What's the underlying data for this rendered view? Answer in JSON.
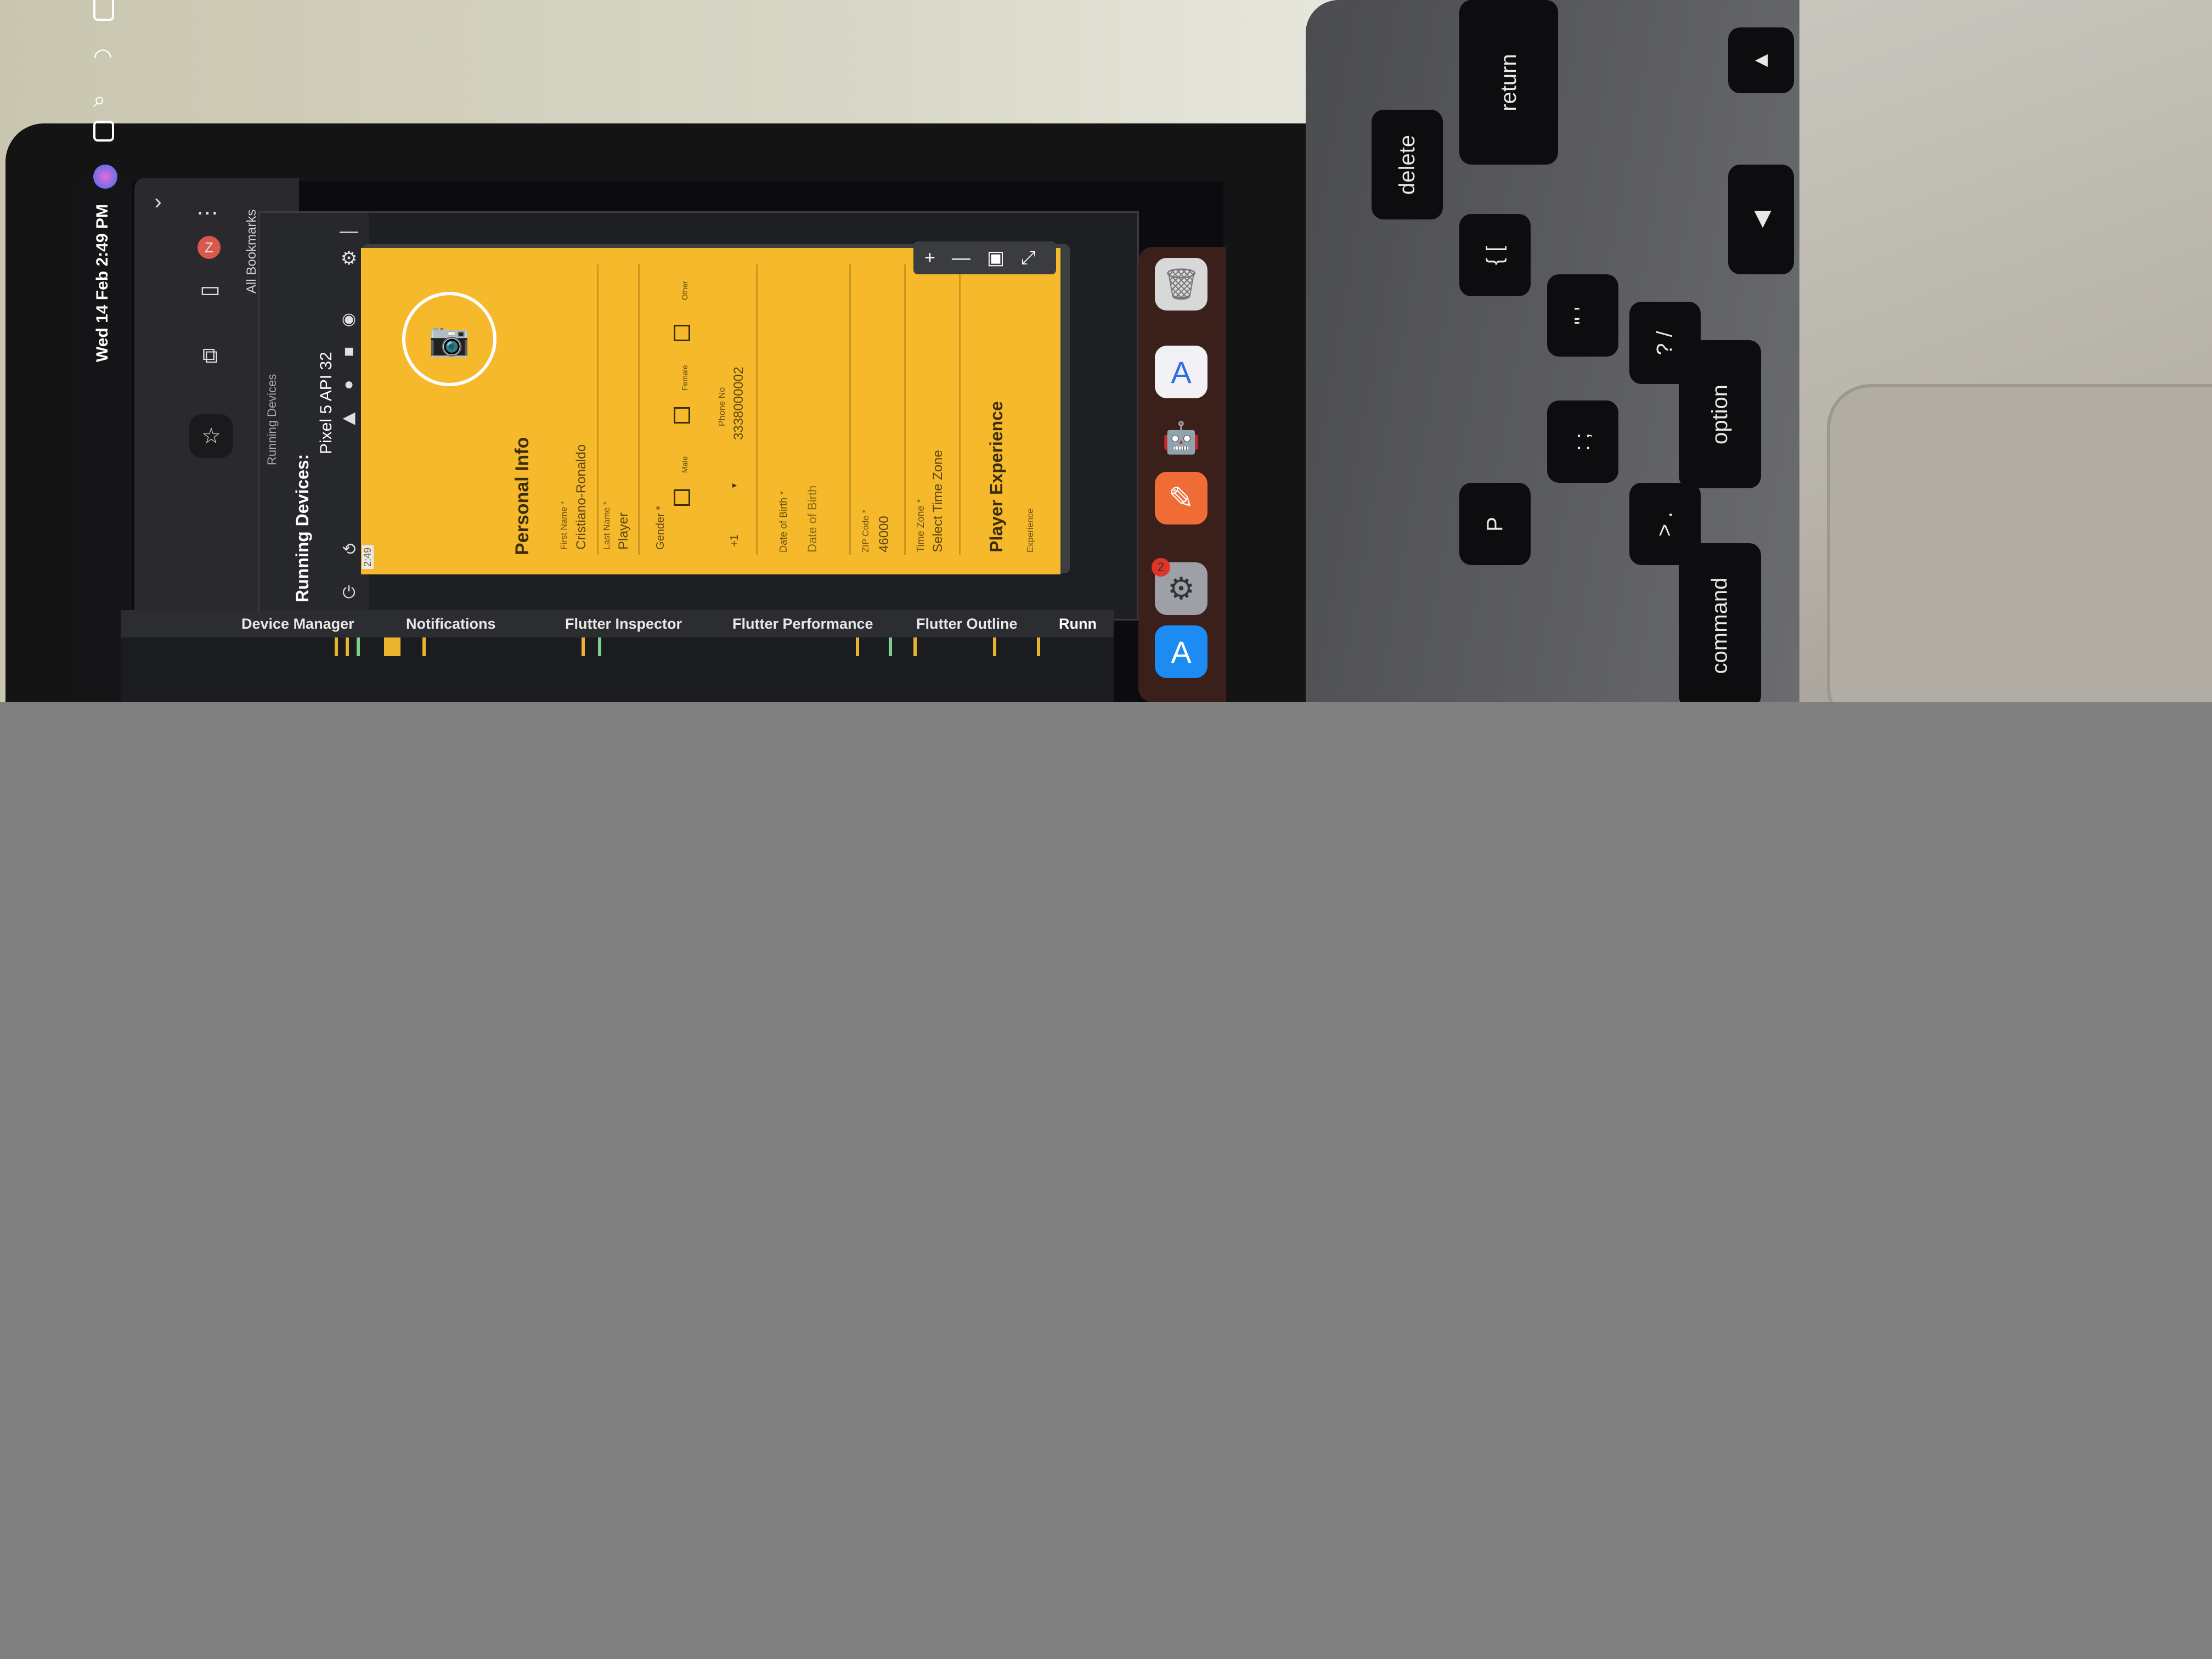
{
  "menubar": {
    "datetime": "Wed 14 Feb  2:49 PM"
  },
  "browser": {
    "bookmarks_label": "All Bookmarks",
    "profile_initial": "Z"
  },
  "ide": {
    "running_devices_title": "Running Devices",
    "running_devices_label": "Running Devices:",
    "device_name": "Pixel 5 API 32",
    "tool_tabs": [
      "Device Manager",
      "Notifications",
      "Flutter Inspector",
      "Flutter Performance",
      "Flutter Outline",
      "Runn"
    ]
  },
  "phone": {
    "status_time": "2:49",
    "section_personal": "Personal Info",
    "first_name_label": "First Name *",
    "first_name_value": "Cristiano-Ronaldo",
    "last_name_label": "Last Name *",
    "last_name_value": "Player",
    "gender_label": "Gender *",
    "gender_options": [
      "Male",
      "Female",
      "Other"
    ],
    "phone_code": "+1",
    "phone_label": "Phone No",
    "phone_value": "3338000002",
    "dob_label": "Date of Birth *",
    "dob_placeholder": "Date of Birth",
    "zip_label": "ZIP Code *",
    "zip_value": "46000",
    "timezone_label": "Time Zone *",
    "timezone_placeholder": "Select Time Zone",
    "section_experience": "Player Experience",
    "experience_label": "Experience"
  },
  "dock": {
    "badge_count": "2"
  },
  "keyboard": {
    "keys": [
      "delete",
      "return",
      "option",
      "command"
    ]
  }
}
